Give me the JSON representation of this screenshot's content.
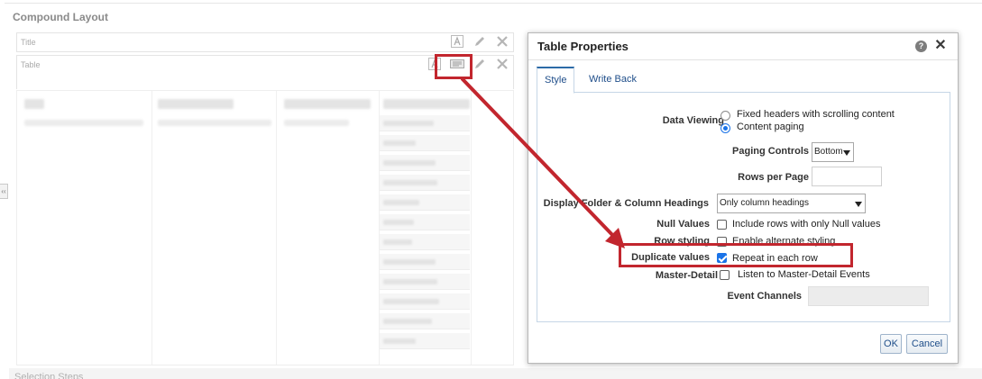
{
  "compound_layout": {
    "title": "Compound Layout",
    "collapse_glyph": "‹‹",
    "views": [
      {
        "label": "Title"
      },
      {
        "label": "Table"
      }
    ],
    "selection_steps_label": "Selection Steps"
  },
  "dialog": {
    "title": "Table Properties",
    "help_glyph": "?",
    "close_glyph": "✕",
    "tabs": [
      {
        "label": "Style",
        "active": true
      },
      {
        "label": "Write Back",
        "active": false
      }
    ],
    "fields": {
      "data_viewing": {
        "label": "Data Viewing",
        "options": [
          {
            "label": "Fixed headers with scrolling content",
            "selected": false
          },
          {
            "label": "Content paging",
            "selected": true
          }
        ]
      },
      "paging_controls": {
        "label": "Paging Controls",
        "value": "Bottom"
      },
      "rows_per_page": {
        "label": "Rows per Page",
        "value": ""
      },
      "display_headings": {
        "label": "Display Folder & Column Headings",
        "value": "Only column headings"
      },
      "null_values": {
        "label": "Null Values",
        "option": "Include rows with only Null values",
        "checked": false
      },
      "row_styling": {
        "label": "Row styling",
        "option": "Enable alternate styling",
        "checked": false
      },
      "duplicate_values": {
        "label": "Duplicate values",
        "option": "Repeat in each row",
        "checked": true
      },
      "master_detail": {
        "label": "Master-Detail",
        "option": "Listen to Master-Detail Events",
        "checked": false
      },
      "event_channels": {
        "label": "Event Channels",
        "value": ""
      }
    },
    "buttons": {
      "ok": "OK",
      "cancel": "Cancel"
    }
  },
  "annotation": {
    "highlight_color": "#c2262e"
  }
}
